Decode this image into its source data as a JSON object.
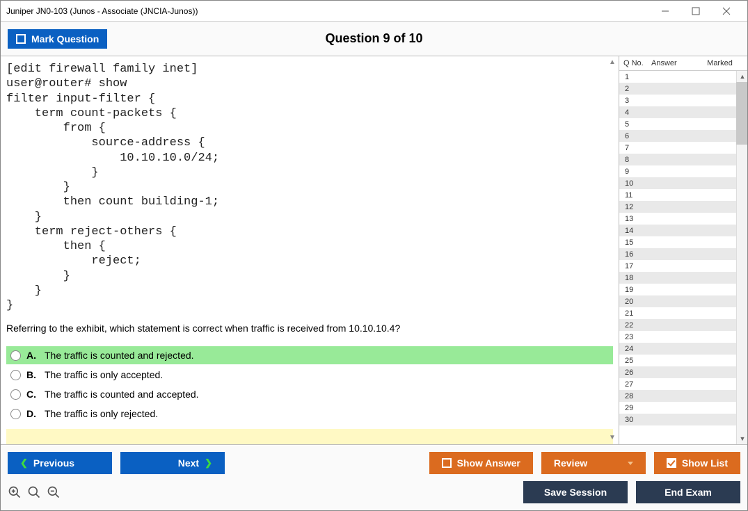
{
  "window": {
    "title": "Juniper JN0-103 (Junos - Associate (JNCIA-Junos))"
  },
  "topbar": {
    "mark_label": "Mark Question",
    "question_title": "Question 9 of 10"
  },
  "question": {
    "code": "[edit firewall family inet]\nuser@router# show\nfilter input-filter {\n    term count-packets {\n        from {\n            source-address {\n                10.10.10.0/24;\n            }\n        }\n        then count building-1;\n    }\n    term reject-others {\n        then {\n            reject;\n        }\n    }\n}",
    "text": "Referring to the exhibit, which statement is correct when traffic is received from 10.10.10.4?",
    "choices": [
      {
        "letter": "A.",
        "text": "The traffic is counted and rejected.",
        "highlight": true
      },
      {
        "letter": "B.",
        "text": "The traffic is only accepted.",
        "highlight": false
      },
      {
        "letter": "C.",
        "text": "The traffic is counted and accepted.",
        "highlight": false
      },
      {
        "letter": "D.",
        "text": "The traffic is only rejected.",
        "highlight": false
      }
    ]
  },
  "sidepanel": {
    "header": {
      "qno": "Q No.",
      "answer": "Answer",
      "marked": "Marked"
    },
    "rows": [
      1,
      2,
      3,
      4,
      5,
      6,
      7,
      8,
      9,
      10,
      11,
      12,
      13,
      14,
      15,
      16,
      17,
      18,
      19,
      20,
      21,
      22,
      23,
      24,
      25,
      26,
      27,
      28,
      29,
      30
    ]
  },
  "footer": {
    "previous": "Previous",
    "next": "Next",
    "show_answer": "Show Answer",
    "review": "Review",
    "show_list": "Show List",
    "save_session": "Save Session",
    "end_exam": "End Exam"
  }
}
